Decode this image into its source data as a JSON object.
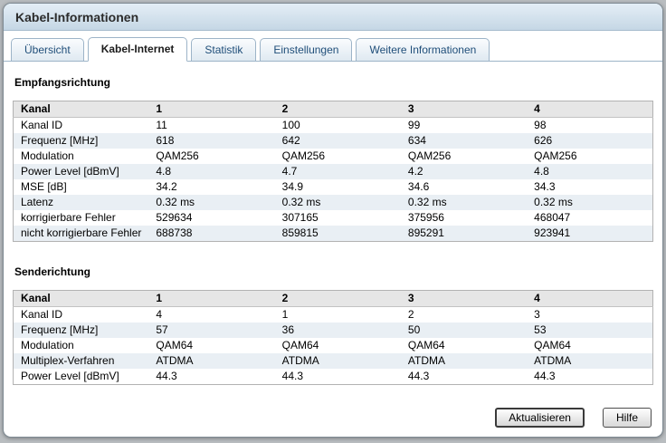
{
  "window": {
    "title": "Kabel-Informationen"
  },
  "tabs": [
    {
      "label": "Übersicht",
      "active": false
    },
    {
      "label": "Kabel-Internet",
      "active": true
    },
    {
      "label": "Statistik",
      "active": false
    },
    {
      "label": "Einstellungen",
      "active": false
    },
    {
      "label": "Weitere Informationen",
      "active": false
    }
  ],
  "sections": [
    {
      "heading": "Empfangsrichtung",
      "table": {
        "headers": [
          "Kanal",
          "1",
          "2",
          "3",
          "4"
        ],
        "rows": [
          [
            "Kanal ID",
            "11",
            "100",
            "99",
            "98"
          ],
          [
            "Frequenz [MHz]",
            "618",
            "642",
            "634",
            "626"
          ],
          [
            "Modulation",
            "QAM256",
            "QAM256",
            "QAM256",
            "QAM256"
          ],
          [
            "Power Level [dBmV]",
            "4.8",
            "4.7",
            "4.2",
            "4.8"
          ],
          [
            "MSE [dB]",
            "34.2",
            "34.9",
            "34.6",
            "34.3"
          ],
          [
            "Latenz",
            "0.32 ms",
            "0.32 ms",
            "0.32 ms",
            "0.32 ms"
          ],
          [
            "korrigierbare Fehler",
            "529634",
            "307165",
            "375956",
            "468047"
          ],
          [
            "nicht korrigierbare Fehler",
            "688738",
            "859815",
            "895291",
            "923941"
          ]
        ]
      }
    },
    {
      "heading": "Senderichtung",
      "table": {
        "headers": [
          "Kanal",
          "1",
          "2",
          "3",
          "4"
        ],
        "rows": [
          [
            "Kanal ID",
            "4",
            "1",
            "2",
            "3"
          ],
          [
            "Frequenz [MHz]",
            "57",
            "36",
            "50",
            "53"
          ],
          [
            "Modulation",
            "QAM64",
            "QAM64",
            "QAM64",
            "QAM64"
          ],
          [
            "Multiplex-Verfahren",
            "ATDMA",
            "ATDMA",
            "ATDMA",
            "ATDMA"
          ],
          [
            "Power Level [dBmV]",
            "44.3",
            "44.3",
            "44.3",
            "44.3"
          ]
        ]
      }
    }
  ],
  "buttons": [
    {
      "label": "Aktualisieren"
    },
    {
      "label": "Hilfe"
    }
  ],
  "colors": {
    "titlebar_top": "#e4eef6",
    "titlebar_bottom": "#c5d7e5",
    "tab_border": "#9db4c8",
    "tab_text": "#1f4e79",
    "table_header_bg": "#e6e6e6",
    "row_stripe": "#e9eff4"
  }
}
